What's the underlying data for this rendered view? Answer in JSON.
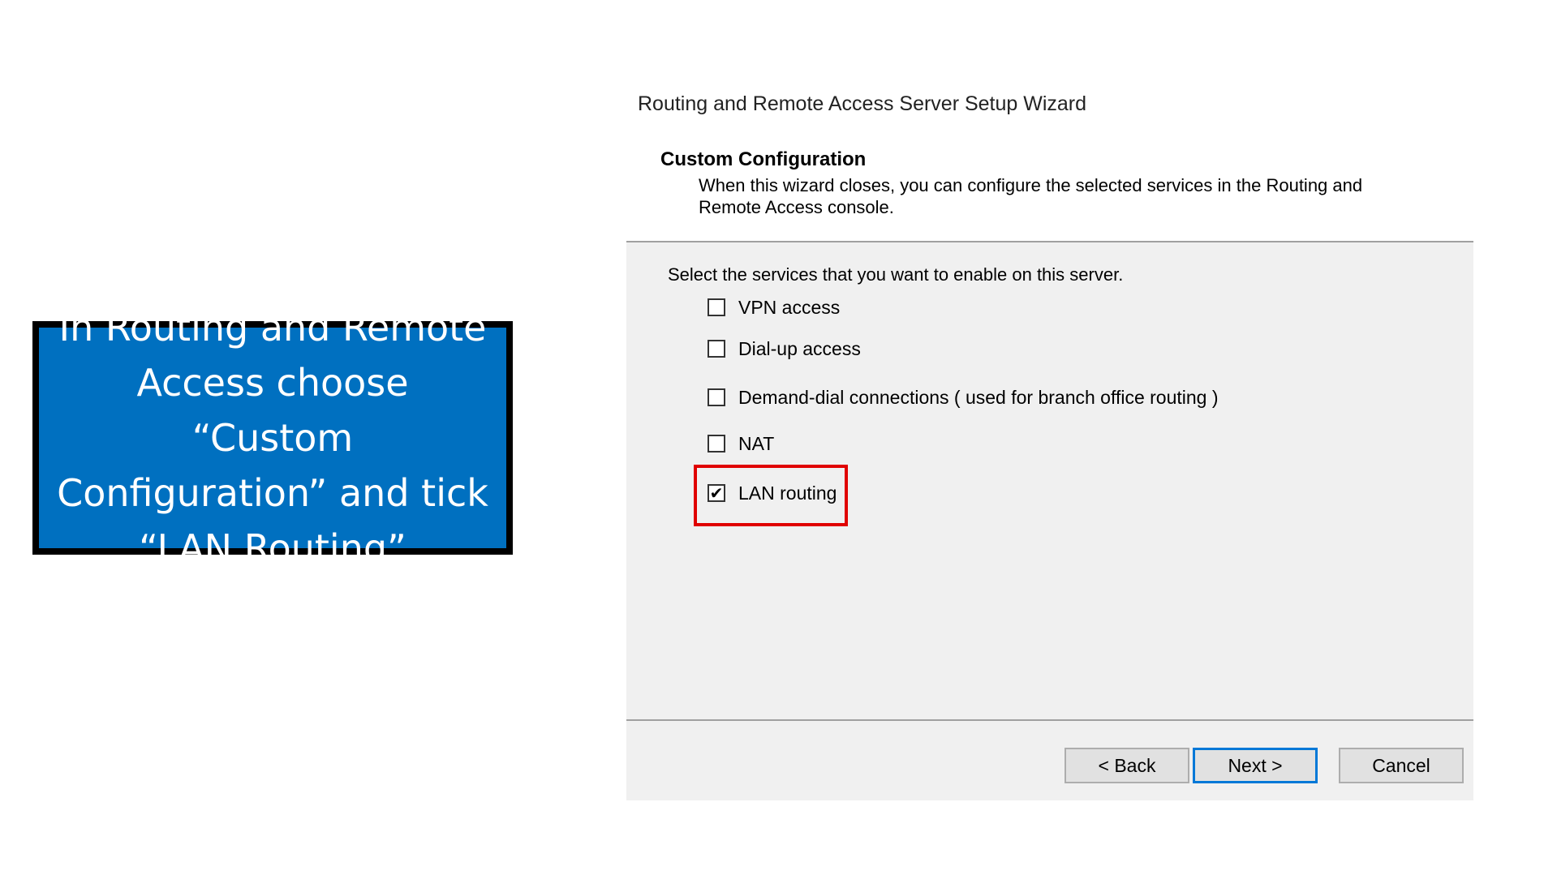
{
  "callout": {
    "text": "In Routing and Remote Access choose “Custom Configuration” and tick “LAN Routing”"
  },
  "dialog": {
    "title": "Routing and Remote Access Server Setup Wizard",
    "section_title": "Custom Configuration",
    "section_description": "When this wizard closes, you can configure the selected services in the Routing and Remote Access console.",
    "prompt": "Select the services that you want to enable on this server.",
    "options": [
      {
        "label": "VPN access",
        "checked": false
      },
      {
        "label": "Dial-up access",
        "checked": false
      },
      {
        "label": "Demand-dial connections ( used for branch office routing )",
        "checked": false
      },
      {
        "label": "NAT",
        "checked": false
      },
      {
        "label": "LAN routing",
        "checked": true
      }
    ],
    "buttons": {
      "back": "< Back",
      "next": "Next >",
      "cancel": "Cancel"
    }
  },
  "colors": {
    "callout_bg": "#0070c0",
    "highlight": "#e00000",
    "primary_button_border": "#0078d7"
  }
}
